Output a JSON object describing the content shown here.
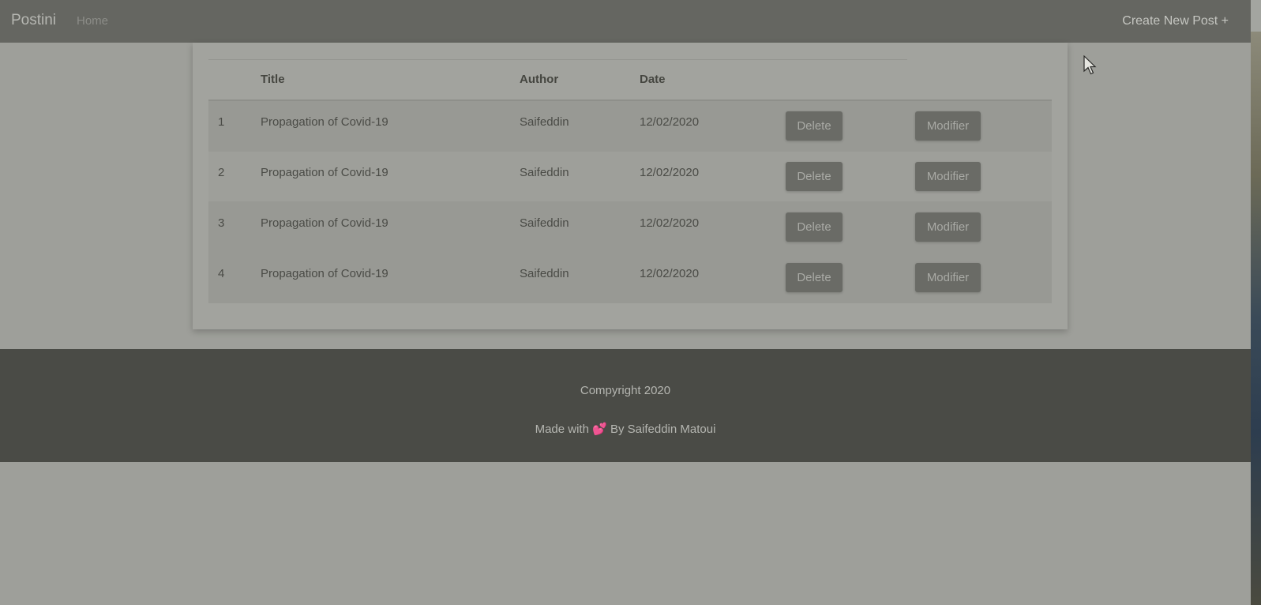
{
  "navbar": {
    "brand": "Postini",
    "home": "Home",
    "create": "Create New Post +"
  },
  "table": {
    "headers": [
      "",
      "Title",
      "Author",
      "Date"
    ],
    "rows": [
      {
        "num": "1",
        "title": "Propagation of Covid-19",
        "author": "Saifeddin",
        "date": "12/02/2020",
        "delete": "Delete",
        "modify": "Modifier"
      },
      {
        "num": "2",
        "title": "Propagation of Covid-19",
        "author": "Saifeddin",
        "date": "12/02/2020",
        "delete": "Delete",
        "modify": "Modifier"
      },
      {
        "num": "3",
        "title": "Propagation of Covid-19",
        "author": "Saifeddin",
        "date": "12/02/2020",
        "delete": "Delete",
        "modify": "Modifier"
      },
      {
        "num": "4",
        "title": "Propagation of Covid-19",
        "author": "Saifeddin",
        "date": "12/02/2020",
        "delete": "Delete",
        "modify": "Modifier"
      }
    ]
  },
  "footer": {
    "copyright": "Compyright 2020",
    "made_prefix": "Made with",
    "heart_icon": "heart-icon",
    "made_suffix": "By Saifeddin Matoui"
  },
  "colors": {
    "navbar": "#656661",
    "footer": "#4a4b46",
    "button": "#6a6b66",
    "overlay_page": "#9e9f9a"
  }
}
